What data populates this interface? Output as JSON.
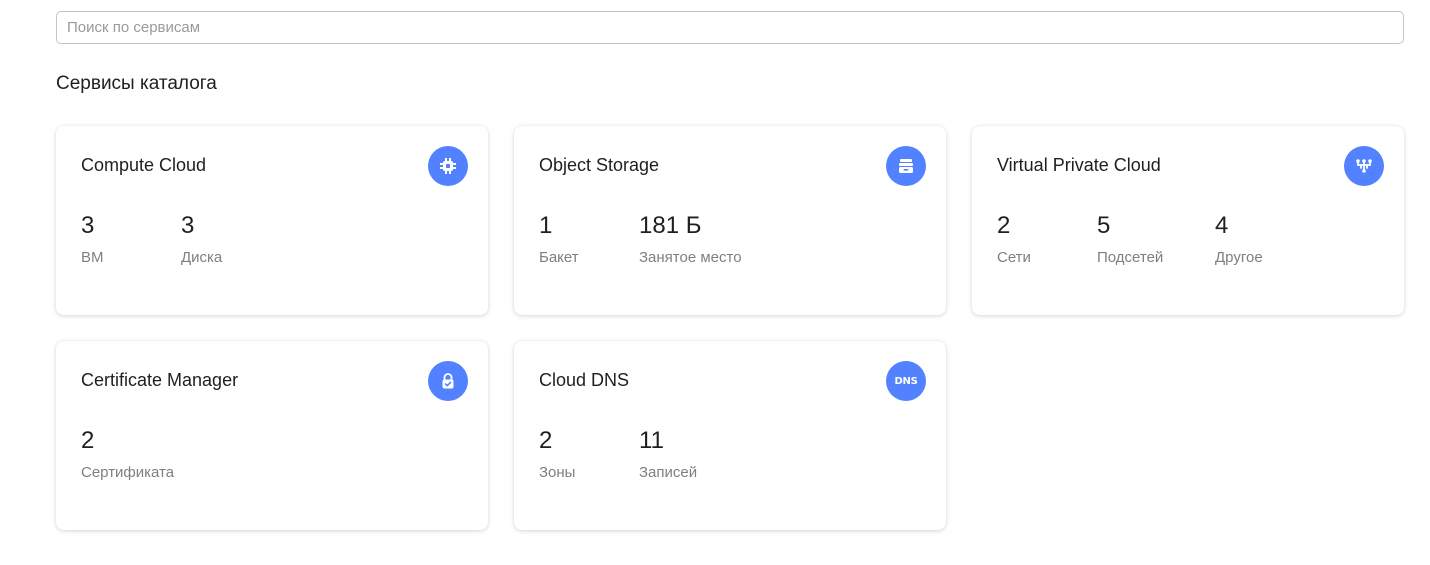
{
  "search": {
    "placeholder": "Поиск по сервисам"
  },
  "section_title": "Сервисы каталога",
  "accent_color": "#5282ff",
  "cards": [
    {
      "title": "Compute Cloud",
      "icon": "chip-icon",
      "stats": [
        {
          "value": "3",
          "label": "ВМ"
        },
        {
          "value": "3",
          "label": "Диска"
        }
      ]
    },
    {
      "title": "Object Storage",
      "icon": "storage-icon",
      "stats": [
        {
          "value": "1",
          "label": "Бакет"
        },
        {
          "value": "181 Б",
          "label": "Занятое место"
        }
      ]
    },
    {
      "title": "Virtual Private Cloud",
      "icon": "network-icon",
      "stats": [
        {
          "value": "2",
          "label": "Сети"
        },
        {
          "value": "5",
          "label": "Подсетей"
        },
        {
          "value": "4",
          "label": "Другое"
        }
      ]
    },
    {
      "title": "Certificate Manager",
      "icon": "lock-icon",
      "stats": [
        {
          "value": "2",
          "label": "Сертификата"
        }
      ]
    },
    {
      "title": "Cloud DNS",
      "icon": "dns-icon",
      "icon_text": "DNS",
      "stats": [
        {
          "value": "2",
          "label": "Зоны"
        },
        {
          "value": "11",
          "label": "Записей"
        }
      ]
    }
  ]
}
